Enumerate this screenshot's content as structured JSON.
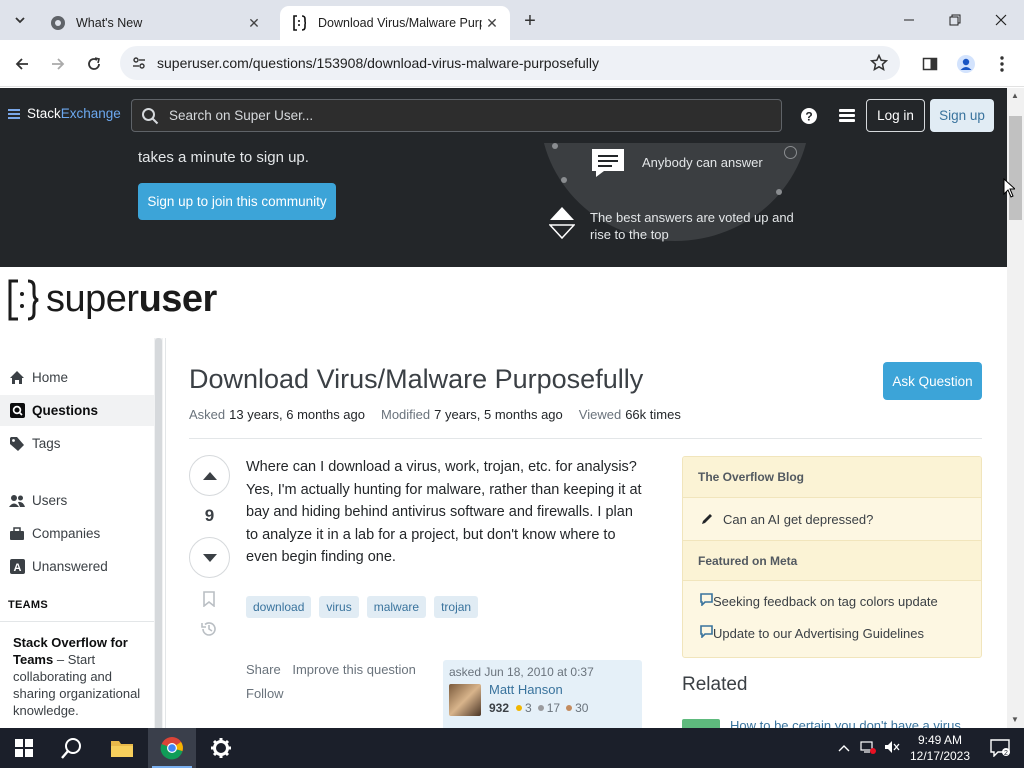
{
  "browser": {
    "tabs": [
      {
        "title": "What's New"
      },
      {
        "title": "Download Virus/Malware Purpo"
      }
    ],
    "url": "superuser.com/questions/153908/download-virus-malware-purposefully"
  },
  "se_header": {
    "brand_a": "Stack",
    "brand_b": "Exchange",
    "search_placeholder": "Search on Super User...",
    "login": "Log in",
    "signup": "Sign up"
  },
  "promo": {
    "text": "takes a minute to sign up.",
    "join_button": "Sign up to join this community",
    "feature1": "Anybody can answer",
    "feature2": "The best answers are voted up and rise to the top"
  },
  "site": {
    "logo_a": "super",
    "logo_b": "user"
  },
  "nav": {
    "items": [
      {
        "label": "Home"
      },
      {
        "label": "Questions"
      },
      {
        "label": "Tags"
      },
      {
        "label": "Users"
      },
      {
        "label": "Companies"
      },
      {
        "label": "Unanswered"
      }
    ],
    "teams_heading": "TEAMS",
    "teams_title": "Stack Overflow for Teams",
    "teams_text": " – Start collaborating and sharing organizational knowledge."
  },
  "question": {
    "title": "Download Virus/Malware Purposefully",
    "ask_button": "Ask Question",
    "asked_label": "Asked",
    "asked_value": "13 years, 6 months ago",
    "modified_label": "Modified",
    "modified_value": "7 years, 5 months ago",
    "viewed_label": "Viewed",
    "viewed_value": "66k times",
    "votes": "9",
    "body": "Where can I download a virus, work, trojan, etc. for analysis? Yes, I'm actually hunting for malware, rather than keeping it at bay and hiding behind antivirus software and firewalls. I plan to analyze it in a lab for a project, but don't know where to even begin finding one.",
    "tags": [
      "download",
      "virus",
      "malware",
      "trojan"
    ],
    "share": "Share",
    "improve": "Improve this question",
    "follow": "Follow",
    "owner": {
      "asked": "asked Jun 18, 2010 at 0:37",
      "name": "Matt Hanson",
      "rep": "932",
      "gold": "3",
      "silver": "17",
      "bronze": "30"
    }
  },
  "sidebar": {
    "blog_heading": "The Overflow Blog",
    "blog_items": [
      "Can an AI get depressed?"
    ],
    "meta_heading": "Featured on Meta",
    "meta_items": [
      "Seeking feedback on tag colors update",
      "Update to our Advertising Guidelines"
    ],
    "related_heading": "Related",
    "related_first": "How to be certain you don't have a virus"
  },
  "taskbar": {
    "time": "9:49 AM",
    "date": "12/17/2023"
  },
  "colors": {
    "accent": "#3ca4d8",
    "dark_header": "#232629",
    "tag_bg": "#e1ecf4",
    "tag_text": "#39739d",
    "widget_bg": "#fdf7e2"
  }
}
